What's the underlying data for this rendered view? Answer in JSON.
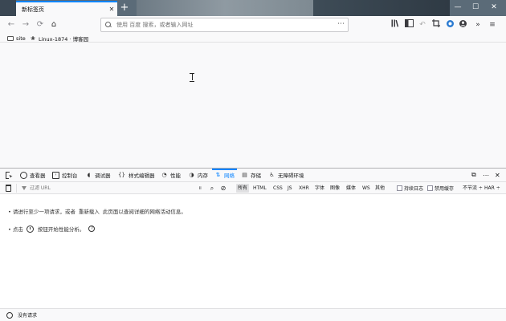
{
  "browser": {
    "tab_title": "新标签页",
    "new_tab_glyph": "+",
    "tab_close_glyph": "✕",
    "window_controls": [
      "—",
      "☐",
      "✕"
    ]
  },
  "navbar": {
    "back_glyph": "←",
    "forward_glyph": "→",
    "reload_glyph": "⟳",
    "home_glyph": "⌂",
    "url_placeholder": "使用 百度 搜索，或者输入网址",
    "url_more_glyph": "⋯",
    "toolbar_icons": [
      "library-icon",
      "sidebar-icon",
      "undo-icon",
      "screenshot-icon",
      "extension-icon",
      "account-icon",
      "overflow-icon",
      "menu-icon"
    ],
    "overflow_glyph": "»",
    "menu_glyph": "≡"
  },
  "bookmarks": [
    {
      "label": "site",
      "icon": "folder-icon"
    },
    {
      "label": "Linux-1874 · 博客园",
      "icon": "paw-icon"
    }
  ],
  "devtools": {
    "tabs": [
      {
        "label": "查看器",
        "icon": "inspector-icon",
        "glyph": "◻"
      },
      {
        "label": "控制台",
        "icon": "console-icon",
        "glyph": "›"
      },
      {
        "label": "调试器",
        "icon": "debugger-icon",
        "glyph": "◖"
      },
      {
        "label": "样式编辑器",
        "icon": "style-editor-icon",
        "glyph": "{}"
      },
      {
        "label": "性能",
        "icon": "performance-icon",
        "glyph": "◔"
      },
      {
        "label": "内存",
        "icon": "memory-icon",
        "glyph": "◑"
      },
      {
        "label": "网络",
        "icon": "network-icon",
        "glyph": "⇅",
        "selected": true
      },
      {
        "label": "存储",
        "icon": "storage-icon",
        "glyph": "▤"
      },
      {
        "label": "无障碍环境",
        "icon": "accessibility-icon",
        "glyph": "♿"
      }
    ],
    "right_controls": [
      "⧉",
      "⋯",
      "✕"
    ],
    "filter_placeholder": "过滤 URL",
    "pause_glyph": "॥",
    "search_glyph": "⌕",
    "block_glyph": "⊘",
    "type_filters": [
      "所有",
      "HTML",
      "CSS",
      "JS",
      "XHR",
      "字体",
      "图像",
      "媒体",
      "WS",
      "其他"
    ],
    "selected_filter": "所有",
    "persist_logs_label": "持续日志",
    "disable_cache_label": "禁用缓存",
    "throttle_label": "不节流 ÷",
    "har_label": "HAR ÷",
    "empty_msg_1": {
      "prefix": "• 请进行至少一项请求，或者",
      "button": "重新载入",
      "suffix": "此页面以查阅详细的网络活动信息。"
    },
    "empty_msg_2": {
      "prefix": "• 点击",
      "button": "按钮开始性能分析。",
      "help": "?"
    },
    "status_text": "没有请求"
  }
}
